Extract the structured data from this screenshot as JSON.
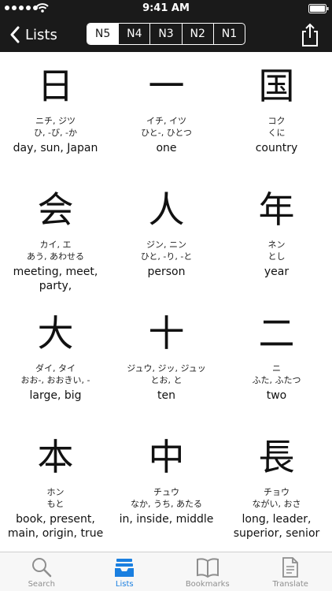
{
  "status_bar": {
    "time": "9:41 AM",
    "signal_dots": 5
  },
  "nav": {
    "back_label": "Lists",
    "levels": [
      {
        "label": "N5",
        "active": true
      },
      {
        "label": "N4",
        "active": false
      },
      {
        "label": "N3",
        "active": false
      },
      {
        "label": "N2",
        "active": false
      },
      {
        "label": "N1",
        "active": false
      }
    ]
  },
  "kanji": [
    {
      "char": "日",
      "on": "ニチ, ジツ",
      "kun": "ひ, -び, -か",
      "meaning": "day, sun, Japan"
    },
    {
      "char": "一",
      "on": "イチ, イツ",
      "kun": "ひと-, ひとつ",
      "meaning": "one"
    },
    {
      "char": "国",
      "on": "コク",
      "kun": "くに",
      "meaning": "country"
    },
    {
      "char": "会",
      "on": "カイ, エ",
      "kun": "あう, あわせる",
      "meaning": "meeting, meet, party,"
    },
    {
      "char": "人",
      "on": "ジン, ニン",
      "kun": "ひと, -り, -と",
      "meaning": "person"
    },
    {
      "char": "年",
      "on": "ネン",
      "kun": "とし",
      "meaning": "year"
    },
    {
      "char": "大",
      "on": "ダイ, タイ",
      "kun": "おお-, おおきい, -",
      "meaning": "large, big"
    },
    {
      "char": "十",
      "on": "ジュウ, ジッ, ジュッ",
      "kun": "とお, と",
      "meaning": "ten"
    },
    {
      "char": "二",
      "on": "ニ",
      "kun": "ふた, ふたつ",
      "meaning": "two"
    },
    {
      "char": "本",
      "on": "ホン",
      "kun": "もと",
      "meaning": "book, present, main, origin, true"
    },
    {
      "char": "中",
      "on": "チュウ",
      "kun": "なか, うち, あたる",
      "meaning": "in, inside, middle"
    },
    {
      "char": "長",
      "on": "チョウ",
      "kun": "ながい, おさ",
      "meaning": "long, leader, superior, senior"
    }
  ],
  "tabs": [
    {
      "label": "Search",
      "icon": "magnifier-icon",
      "active": false
    },
    {
      "label": "Lists",
      "icon": "tray-icon",
      "active": true
    },
    {
      "label": "Bookmarks",
      "icon": "book-icon",
      "active": false
    },
    {
      "label": "Translate",
      "icon": "document-icon",
      "active": false
    }
  ],
  "colors": {
    "bar": "#1a1a1a",
    "accent": "#1a7fe0",
    "tab_inactive": "#8e8e8e"
  }
}
